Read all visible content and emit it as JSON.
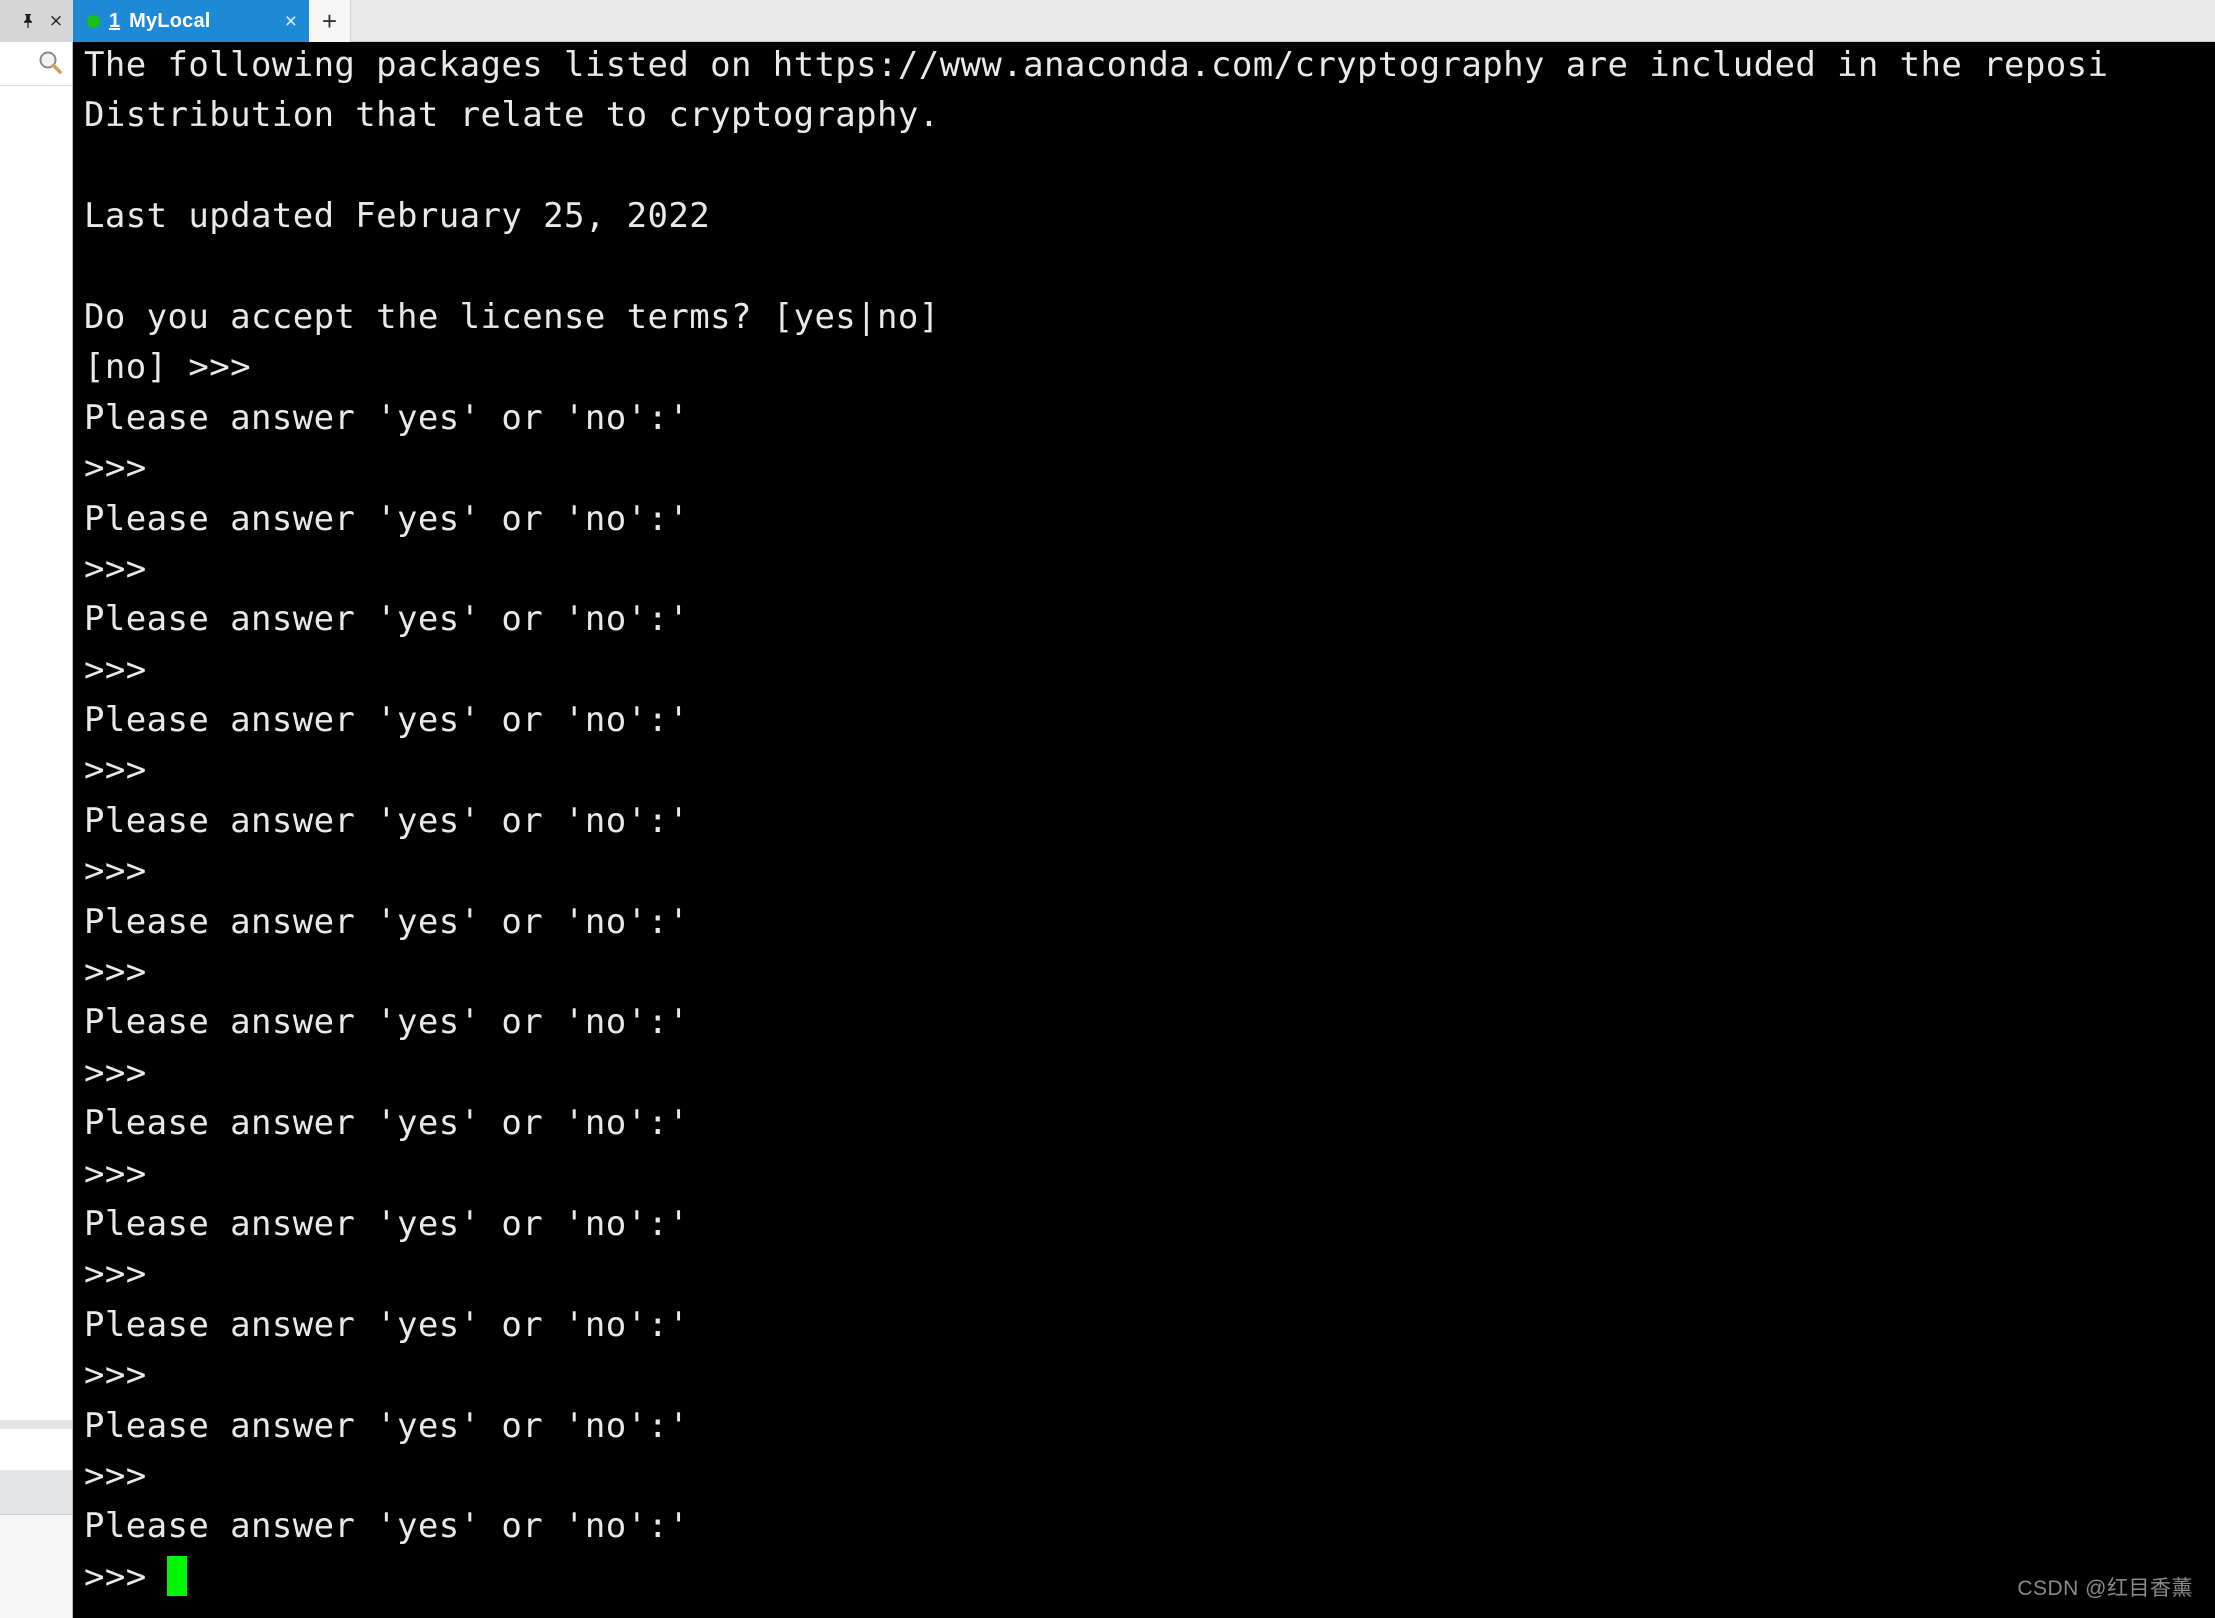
{
  "window": {
    "pin_icon": "pin-icon",
    "close_icon": "×"
  },
  "tabs": {
    "items": [
      {
        "index": "1",
        "label": "MyLocal",
        "status_color": "#18c018",
        "close_label": "×",
        "active": true
      }
    ],
    "new_tab_label": "+"
  },
  "sidebar": {
    "search_icon": "search-icon"
  },
  "terminal": {
    "background": "#000000",
    "foreground": "#e9e9e9",
    "cursor_color": "#00f600",
    "lines": [
      "The following packages listed on https://www.anaconda.com/cryptography are included in the reposi",
      "Distribution that relate to cryptography.",
      "",
      "Last updated February 25, 2022",
      "",
      "Do you accept the license terms? [yes|no]",
      "[no] >>> ",
      "Please answer 'yes' or 'no':'",
      ">>> ",
      "Please answer 'yes' or 'no':'",
      ">>> ",
      "Please answer 'yes' or 'no':'",
      ">>> ",
      "Please answer 'yes' or 'no':'",
      ">>> ",
      "Please answer 'yes' or 'no':'",
      ">>> ",
      "Please answer 'yes' or 'no':'",
      ">>> ",
      "Please answer 'yes' or 'no':'",
      ">>> ",
      "Please answer 'yes' or 'no':'",
      ">>> ",
      "Please answer 'yes' or 'no':'",
      ">>> ",
      "Please answer 'yes' or 'no':'",
      ">>> ",
      "Please answer 'yes' or 'no':'",
      ">>> ",
      "Please answer 'yes' or 'no':'",
      ">>> "
    ],
    "cursor_line_index": 30
  },
  "watermark": {
    "text": "CSDN @红目香薰"
  }
}
